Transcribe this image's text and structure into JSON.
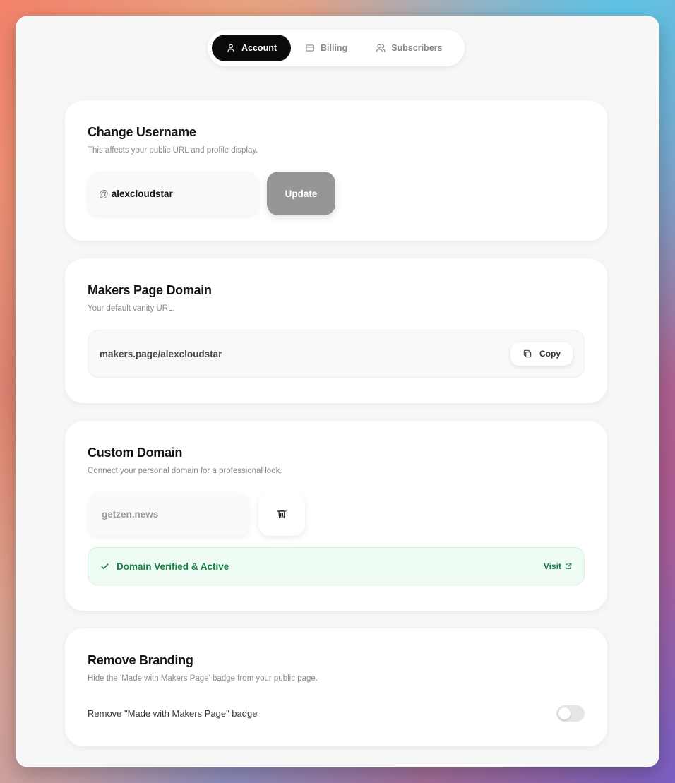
{
  "tabs": [
    {
      "label": "Account",
      "icon": "user-icon",
      "active": true
    },
    {
      "label": "Billing",
      "icon": "credit-card-icon",
      "active": false
    },
    {
      "label": "Subscribers",
      "icon": "users-icon",
      "active": false
    }
  ],
  "username_card": {
    "title": "Change Username",
    "description": "This affects your public URL and profile display.",
    "prefix": "@",
    "value": "alexcloudstar",
    "update_label": "Update"
  },
  "domain_card": {
    "title": "Makers Page Domain",
    "description": "Your default vanity URL.",
    "url": "makers.page/alexcloudstar",
    "copy_label": "Copy"
  },
  "custom_card": {
    "title": "Custom Domain",
    "description": "Connect your personal domain for a professional look.",
    "domain_value": "getzen.news",
    "status_text": "Domain Verified & Active",
    "visit_label": "Visit",
    "status_color": "#18804a"
  },
  "branding_card": {
    "title": "Remove Branding",
    "description": "Hide the 'Made with Makers Page' badge from your public page.",
    "toggle_label": "Remove \"Made with Makers Page\" badge",
    "toggle_on": false
  }
}
